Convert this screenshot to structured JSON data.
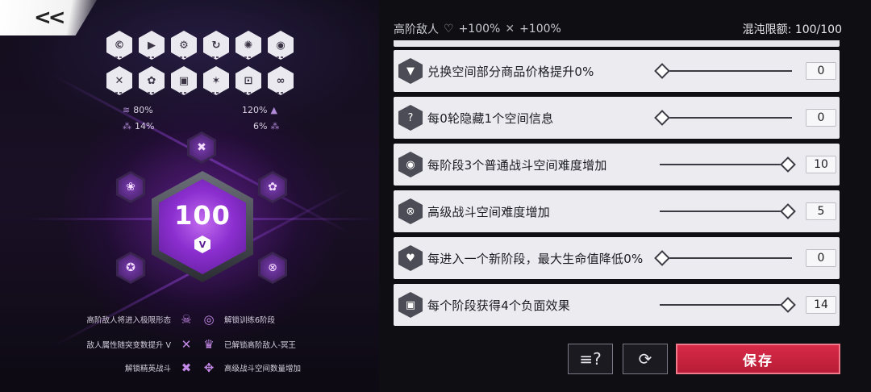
{
  "back_button": {
    "label": "<<"
  },
  "left_panel": {
    "top_icons_row1": [
      "©",
      "▶",
      "⚙",
      "↻",
      "✺",
      "◉"
    ],
    "top_icons_row2": [
      "✕",
      "✿",
      "▣",
      "✶",
      "⊡",
      "∞"
    ],
    "stats": {
      "tl": {
        "symbol": "≋",
        "value": "80%"
      },
      "tr": {
        "symbol": "▲",
        "value": "120%"
      },
      "bl": {
        "symbol": "⁂",
        "value": "14%"
      },
      "br": {
        "symbol": "⁂",
        "value": "6%"
      }
    },
    "center_value": "100",
    "satellite_icons": [
      "✖",
      "❀",
      "✿",
      "✪",
      "⊗"
    ],
    "legend": [
      {
        "left_text": "高阶敌人将进入极限形态",
        "left_icon": "☠",
        "right_icon": "◎",
        "right_text": "解锁训练6阶段"
      },
      {
        "left_text": "敌人属性随突变数提升 V",
        "left_icon": "✕",
        "right_icon": "♛",
        "right_text": "已解锁高阶敌人-冥王"
      },
      {
        "left_text": "解锁精英战斗",
        "left_icon": "✖",
        "right_icon": "✥",
        "right_text": "高级战斗空间数量增加"
      }
    ]
  },
  "topbar": {
    "enemy_label": "高阶敌人",
    "enemy_icon": "heart-icon",
    "enemy_value1": "+100%",
    "crossed_swords": "crossed-swords-icon",
    "enemy_value2": "+100%",
    "chaos_label": "混沌限额: 100/100"
  },
  "modifiers": [
    {
      "icon": "▼",
      "text": "兑换空间部分商品价格提升0%",
      "value": "0",
      "fraction": 0.0
    },
    {
      "icon": "?",
      "text": "每0轮隐藏1个空间信息",
      "value": "0",
      "fraction": 0.0
    },
    {
      "icon": "◉",
      "text": "每阶段3个普通战斗空间难度增加",
      "value": "10",
      "fraction": 1.0
    },
    {
      "icon": "⊗",
      "text": "高级战斗空间难度增加",
      "value": "5",
      "fraction": 1.0
    },
    {
      "icon": "♥",
      "text": "每进入一个新阶段，最大生命值降低0%",
      "value": "0",
      "fraction": 0.0
    },
    {
      "icon": "▣",
      "text": "每个阶段获得4个负面效果",
      "value": "14",
      "fraction": 1.0
    }
  ],
  "buttons": {
    "help_icon": "≡?",
    "refresh_icon": "⟳",
    "save": "保存"
  }
}
